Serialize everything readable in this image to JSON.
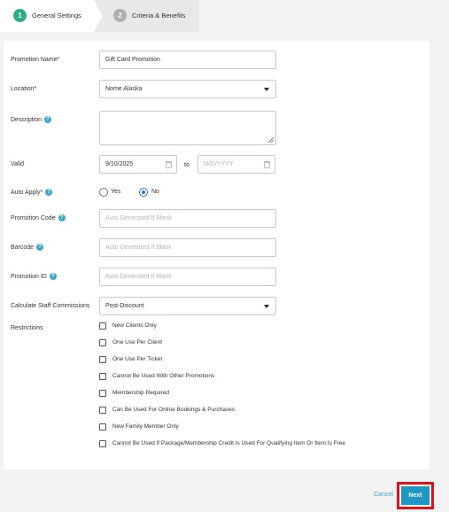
{
  "stepper": {
    "steps": [
      {
        "number": "1",
        "label": "General Settings",
        "color": "#2bab87"
      },
      {
        "number": "2",
        "label": "Criteria & Benefits",
        "color": "#b0b0b0"
      }
    ]
  },
  "form": {
    "promotion_name": {
      "label": "Promotion Name*",
      "value": "Gift Card Promotion"
    },
    "location": {
      "label": "Location*",
      "value": "Nome Alaska"
    },
    "description": {
      "label": "Description",
      "value": ""
    },
    "valid": {
      "label": "Valid",
      "start": "9/10/2025",
      "to_label": "to",
      "end_placeholder": "M/D/YYYY"
    },
    "auto_apply": {
      "label": "Auto Apply*",
      "yes": "Yes",
      "no": "No",
      "selected": "No"
    },
    "promotion_code": {
      "label": "Promotion Code",
      "placeholder": "Auto Generated If Blank"
    },
    "barcode": {
      "label": "Barcode",
      "placeholder": "Auto Generated If Blank"
    },
    "promotion_id": {
      "label": "Promotion ID",
      "placeholder": "Auto Generated If Blank"
    },
    "staff_commissions": {
      "label": "Calculate Staff Commissions",
      "value": "Post-Discount"
    },
    "restrictions": {
      "label": "Restrictions",
      "options": [
        "New Clients Only",
        "One Use Per Client",
        "One Use Per Ticket",
        "Cannot Be Used With Other Promotions",
        "Membership Required",
        "Can Be Used For Online Bookings & Purchases",
        "New Family Member Only",
        "Cannot Be Used If Package/Membership Credit Is Used For Qualifying Item Or Item Is Free"
      ]
    }
  },
  "help_icon_glyph": "?",
  "footer": {
    "cancel": "Cancel",
    "next": "Next"
  }
}
